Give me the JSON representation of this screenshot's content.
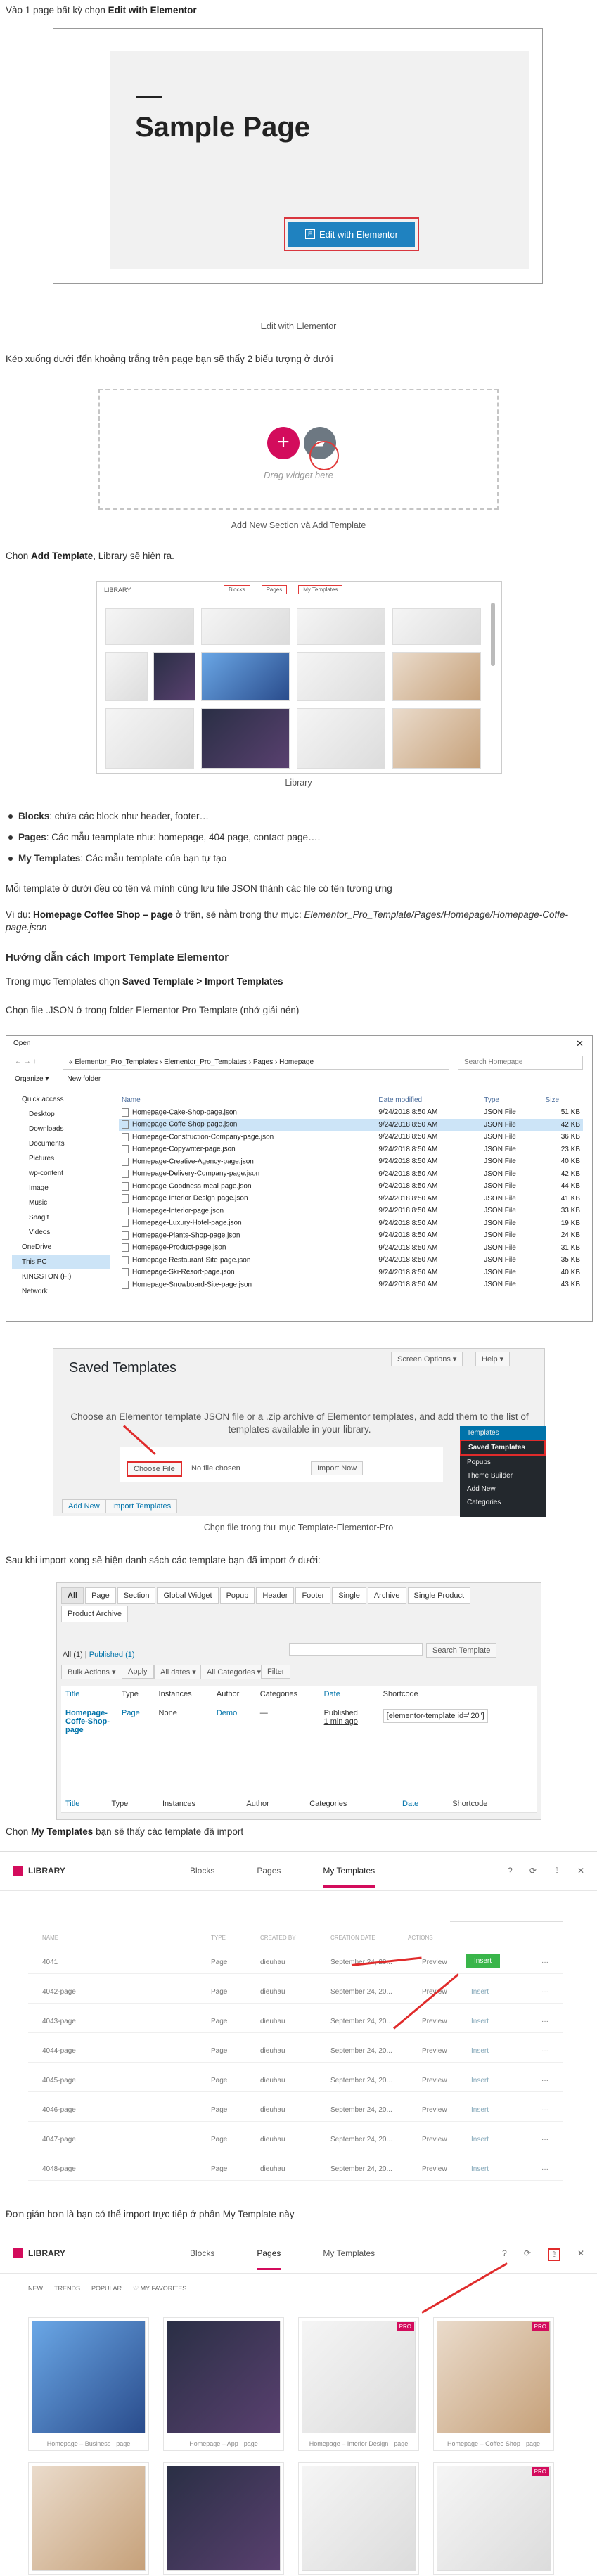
{
  "intro": {
    "pre": "Vào 1 page bất kỳ chọn ",
    "bold": "Edit with Elementor"
  },
  "sample_page": {
    "title": "Sample Page",
    "button": "Edit with Elementor",
    "caption": "Edit with Elementor"
  },
  "scroll_text": "Kéo xuống dưới đến khoảng trắng trên page bạn sẽ thấy 2 biểu tượng ở dưới",
  "dropzone": {
    "plus": "+",
    "label": "Drag widget here",
    "caption": "Add New Section và Add Template"
  },
  "choose": {
    "pre": "Chọn ",
    "bold": "Add Template",
    "post": ", Library sẽ hiện ra."
  },
  "library_small": {
    "title": "LIBRARY",
    "tabs": [
      "Blocks",
      "Pages",
      "My Templates"
    ],
    "caption": "Library"
  },
  "bullets": [
    {
      "bold": "Blocks",
      "text": ": chứa các block như header, footer…"
    },
    {
      "bold": "Pages",
      "text": ": Các mẫu teamplate như: homepage, 404 page, contact page…."
    },
    {
      "bold": "My Templates",
      "text": ": Các mẫu template của bạn tự tạo"
    }
  ],
  "note_json": "Mỗi template ở dưới đều có tên và mình cũng lưu file JSON thành các file có tên tương ứng",
  "example": {
    "pre": "Ví dụ: ",
    "bold": "Homepage Coffee Shop – page",
    "mid": " ở trên, sẽ nằm trong thư mục: ",
    "path": "Elementor_Pro_Template/Pages/Homepage/Homepage-Coffe-page.json"
  },
  "heading_import": "Hướng dẫn cách Import Template Elementor",
  "step1": {
    "pre": "Trong mục Templates chọn ",
    "bold": "Saved Template > Import Templates"
  },
  "step2": "Chọn file .JSON ở trong folder Elementor Pro Template (nhớ giải nén)",
  "open_dialog": {
    "title": "Open",
    "address": [
      "«",
      "Elementor_Pro_Templates",
      "›",
      "Elementor_Pro_Templates",
      "›",
      "Pages",
      "›",
      "Homepage"
    ],
    "search": "Search Homepage",
    "organize": "Organize ▾",
    "new_folder": "New folder",
    "nav": [
      "Quick access",
      "Desktop",
      "Downloads",
      "Documents",
      "Pictures",
      "wp-content",
      "Image",
      "Music",
      "Snagit",
      "Videos",
      "OneDrive",
      "This PC",
      "KINGSTON (F:)",
      "Network"
    ],
    "columns": [
      "Name",
      "Date modified",
      "Type",
      "Size"
    ],
    "files": [
      [
        "Homepage-Cake-Shop-page.json",
        "9/24/2018 8:50 AM",
        "JSON File",
        "51 KB"
      ],
      [
        "Homepage-Coffe-Shop-page.json",
        "9/24/2018 8:50 AM",
        "JSON File",
        "42 KB"
      ],
      [
        "Homepage-Construction-Company-page.json",
        "9/24/2018 8:50 AM",
        "JSON File",
        "36 KB"
      ],
      [
        "Homepage-Copywriter-page.json",
        "9/24/2018 8:50 AM",
        "JSON File",
        "23 KB"
      ],
      [
        "Homepage-Creative-Agency-page.json",
        "9/24/2018 8:50 AM",
        "JSON File",
        "40 KB"
      ],
      [
        "Homepage-Delivery-Company-page.json",
        "9/24/2018 8:50 AM",
        "JSON File",
        "42 KB"
      ],
      [
        "Homepage-Goodness-meal-page.json",
        "9/24/2018 8:50 AM",
        "JSON File",
        "44 KB"
      ],
      [
        "Homepage-Interior-Design-page.json",
        "9/24/2018 8:50 AM",
        "JSON File",
        "41 KB"
      ],
      [
        "Homepage-Interior-page.json",
        "9/24/2018 8:50 AM",
        "JSON File",
        "33 KB"
      ],
      [
        "Homepage-Luxury-Hotel-page.json",
        "9/24/2018 8:50 AM",
        "JSON File",
        "19 KB"
      ],
      [
        "Homepage-Plants-Shop-page.json",
        "9/24/2018 8:50 AM",
        "JSON File",
        "24 KB"
      ],
      [
        "Homepage-Product-page.json",
        "9/24/2018 8:50 AM",
        "JSON File",
        "31 KB"
      ],
      [
        "Homepage-Restaurant-Site-page.json",
        "9/24/2018 8:50 AM",
        "JSON File",
        "35 KB"
      ],
      [
        "Homepage-Ski-Resort-page.json",
        "9/24/2018 8:50 AM",
        "JSON File",
        "40 KB"
      ],
      [
        "Homepage-Snowboard-Site-page.json",
        "9/24/2018 8:50 AM",
        "JSON File",
        "43 KB"
      ]
    ]
  },
  "saved_templates": {
    "title": "Saved Templates",
    "screen_options": "Screen Options ▾",
    "help": "Help ▾",
    "desc": "Choose an Elementor template JSON file or a .zip archive of Elementor templates, and add them to the list of templates available in your library.",
    "choose_file": "Choose File",
    "no_file": "No file chosen",
    "import_now": "Import Now",
    "add_new": "Add New",
    "import_templates": "Import Templates",
    "menu": [
      "Templates",
      "Saved Templates",
      "Popups",
      "Theme Builder",
      "Add New",
      "Categories"
    ],
    "caption": "Chọn file trong thư mục Template-Elementor-Pro"
  },
  "after_import": "Sau khi import xong sẽ hiện danh sách các template bạn đã import ở dưới:",
  "import_list": {
    "filters": [
      "All",
      "Page",
      "Section",
      "Global Widget",
      "Popup",
      "Header",
      "Footer",
      "Single",
      "Archive",
      "Single Product",
      "Product Archive"
    ],
    "all": "All",
    "all_count": "(1)",
    "published": "Published (1)",
    "search_btn": "Search Template",
    "bulk": "Bulk Actions ▾",
    "apply": "Apply",
    "dates": "All dates ▾",
    "cats": "All Categories ▾",
    "filter": "Filter",
    "columns": [
      "Title",
      "Type",
      "Instances",
      "Author",
      "Categories",
      "Date",
      "Shortcode"
    ],
    "row": {
      "title": "Homepage-Coffe-Shop-page",
      "type": "Page",
      "instances": "None",
      "author": "Demo",
      "categories": "—",
      "date": "Published",
      "ago": "1 min ago",
      "shortcode": "[elementor-template id=\"20\"]"
    }
  },
  "my_templates_text": {
    "pre": "Chọn ",
    "bold": "My Templates",
    "post": " bạn sẽ thấy các template đã import"
  },
  "library_big": {
    "title": "LIBRARY",
    "tabs": [
      "Blocks",
      "Pages",
      "My Templates"
    ],
    "columns": [
      "NAME",
      "TYPE",
      "CREATED BY",
      "CREATION DATE",
      "ACTIONS"
    ],
    "rows": [
      {
        "name": "4041",
        "type": "Page",
        "by": "dieuhau",
        "date": "September 24, 20..."
      },
      {
        "name": "4042-page",
        "type": "Page",
        "by": "dieuhau",
        "date": "September 24, 20..."
      },
      {
        "name": "4043-page",
        "type": "Page",
        "by": "dieuhau",
        "date": "September 24, 20..."
      },
      {
        "name": "4044-page",
        "type": "Page",
        "by": "dieuhau",
        "date": "September 24, 20..."
      },
      {
        "name": "4045-page",
        "type": "Page",
        "by": "dieuhau",
        "date": "September 24, 20..."
      },
      {
        "name": "4046-page",
        "type": "Page",
        "by": "dieuhau",
        "date": "September 24, 20..."
      },
      {
        "name": "4047-page",
        "type": "Page",
        "by": "dieuhau",
        "date": "September 24, 20..."
      },
      {
        "name": "4048-page",
        "type": "Page",
        "by": "dieuhau",
        "date": "September 24, 20..."
      }
    ],
    "preview": "Preview",
    "insert": "Insert"
  },
  "simpler": "Đơn giản hơn là bạn có thể import trực tiếp ở phần My Template này",
  "library_pages": {
    "filters": [
      "NEW",
      "TRENDS",
      "POPULAR"
    ],
    "favorites": "MY FAVORITES",
    "cards": [
      "Homepage – Business · page",
      "Homepage – App · page",
      "Homepage – Interior Design · page",
      "Homepage – Coffee Shop · page"
    ],
    "pro": "PRO"
  },
  "colors": {
    "accent": "#d30c5c",
    "elementor_blue": "#1f82c0",
    "highlight_red": "#e02b2b",
    "insert_green": "#39b54a"
  }
}
